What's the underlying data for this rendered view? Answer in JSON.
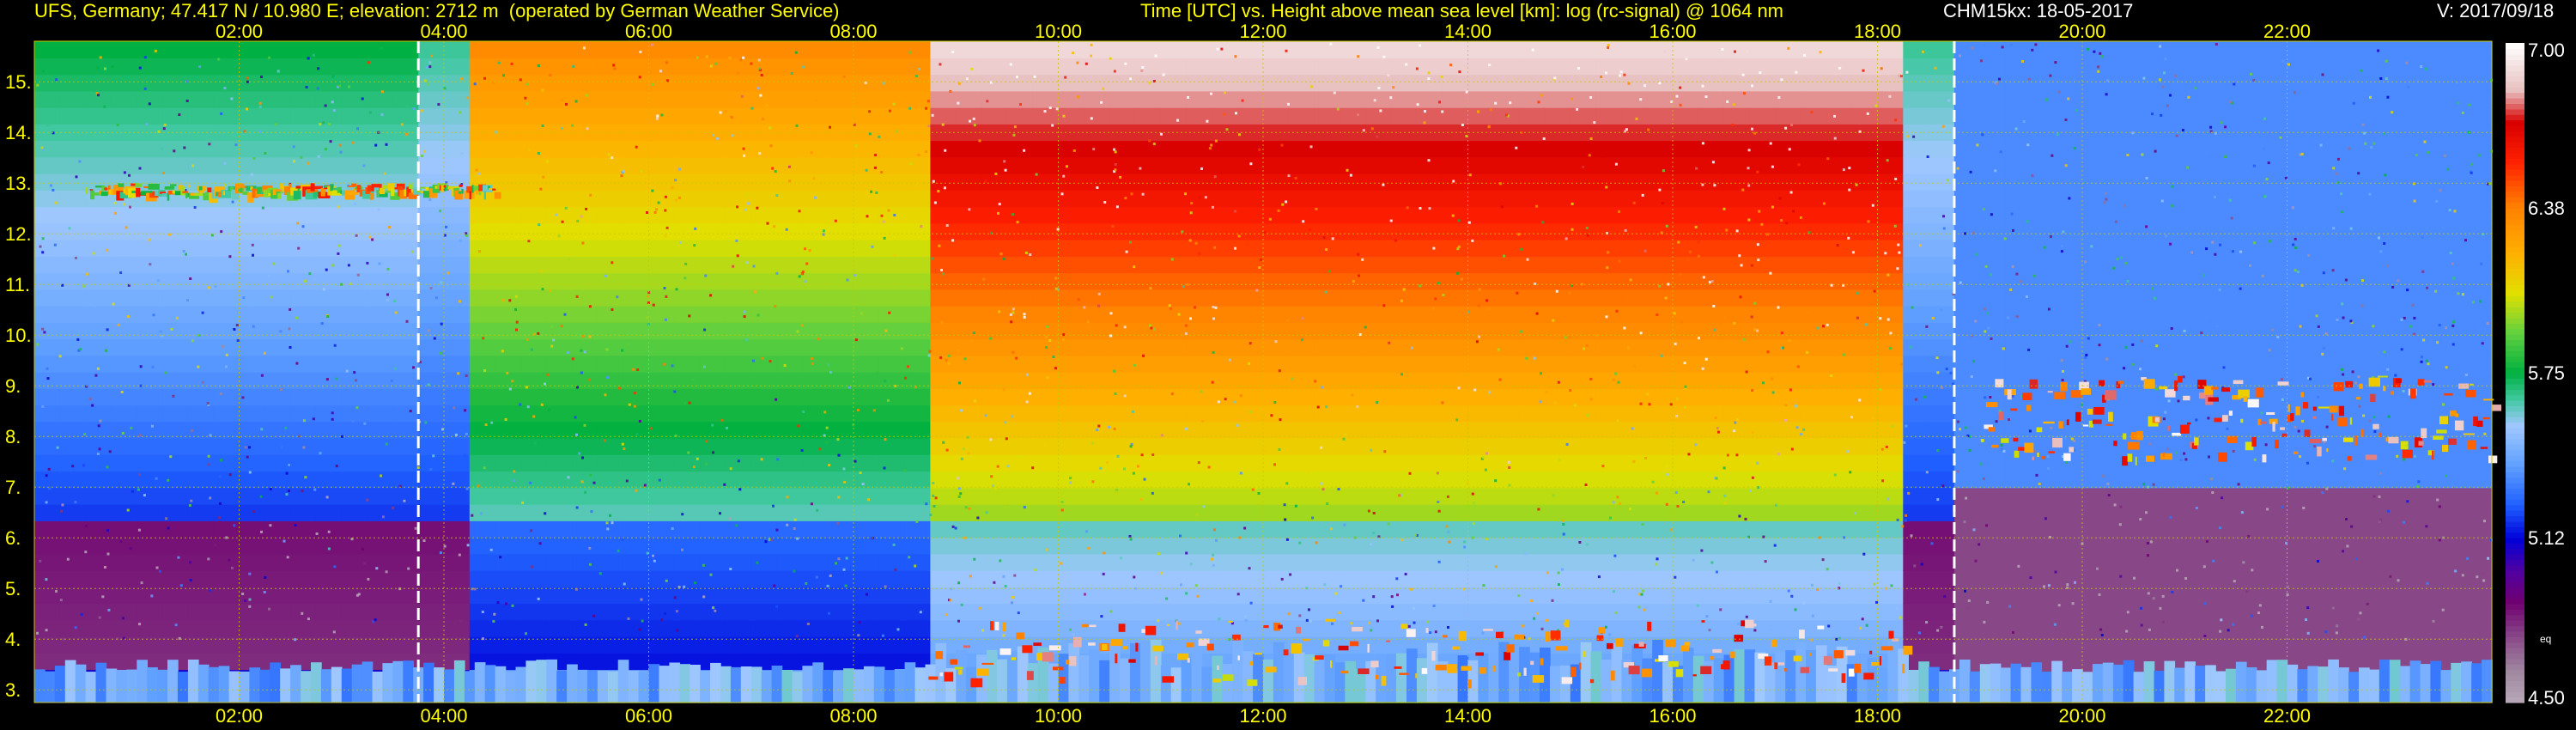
{
  "header": {
    "site": "UFS, Germany; 47.417 N / 10.980 E; elevation: 2712 m  (operated by German Weather Service)",
    "plot_description": "Time [UTC] vs. Height above mean sea level [km]: log (rc-signal) @ 1064 nm",
    "instrument_date": "CHM15kx: 18-05-2017",
    "version": "V: 2017/09/18"
  },
  "colors": {
    "background": "#000000",
    "grid": "#c8c800",
    "header_text": "#ffff00",
    "marker_lines": "#ffffff"
  },
  "chart_data": {
    "type": "heatmap",
    "title": "Time [UTC] vs. Height above mean sea level [km]: log (rc-signal) @ 1064 nm",
    "x_axis": {
      "quantity": "Time [UTC]",
      "range_hours": [
        0.0,
        24.0
      ],
      "ticks": [
        "02:00",
        "04:00",
        "06:00",
        "08:00",
        "10:00",
        "12:00",
        "14:00",
        "16:00",
        "18:00",
        "20:00",
        "22:00"
      ],
      "tick_hours": [
        2,
        4,
        6,
        8,
        10,
        12,
        14,
        16,
        18,
        20,
        22
      ],
      "labels_top_and_bottom": true
    },
    "y_axis": {
      "quantity": "Height above mean sea level [km]",
      "range_km": [
        2.75,
        15.8
      ],
      "ticks": [
        "3.",
        "4.",
        "5.",
        "6.",
        "7.",
        "8.",
        "9.",
        "10.",
        "11.",
        "12.",
        "13.",
        "14.",
        "15."
      ],
      "tick_values": [
        3,
        4,
        5,
        6,
        7,
        8,
        9,
        10,
        11,
        12,
        13,
        14,
        15
      ]
    },
    "grid": true,
    "vertical_markers_hours": [
      3.75,
      18.75
    ],
    "colorbar": {
      "placement": "right",
      "range": [
        4.5,
        7.0
      ],
      "ticks": [
        "7.00",
        "6.38",
        "5.75",
        "5.12",
        "4.50"
      ],
      "tick_values": [
        7.0,
        6.375,
        5.75,
        5.125,
        4.5
      ],
      "extra_label": "eq",
      "stops": [
        {
          "v": 4.5,
          "c": "#b8a8b8"
        },
        {
          "v": 4.62,
          "c": "#a088a0"
        },
        {
          "v": 4.75,
          "c": "#884888"
        },
        {
          "v": 4.88,
          "c": "#700070"
        },
        {
          "v": 5.0,
          "c": "#5000a0"
        },
        {
          "v": 5.12,
          "c": "#0000d8"
        },
        {
          "v": 5.25,
          "c": "#2060ff"
        },
        {
          "v": 5.4,
          "c": "#60a0ff"
        },
        {
          "v": 5.55,
          "c": "#a0c8ff"
        },
        {
          "v": 5.65,
          "c": "#40c8a0"
        },
        {
          "v": 5.75,
          "c": "#00b040"
        },
        {
          "v": 5.9,
          "c": "#60d040"
        },
        {
          "v": 6.05,
          "c": "#e0e000"
        },
        {
          "v": 6.2,
          "c": "#ffb000"
        },
        {
          "v": 6.38,
          "c": "#ff8000"
        },
        {
          "v": 6.55,
          "c": "#ff2000"
        },
        {
          "v": 6.7,
          "c": "#d80000"
        },
        {
          "v": 6.82,
          "c": "#e8c0c0"
        },
        {
          "v": 7.0,
          "c": "#ffffff"
        }
      ]
    },
    "features": [
      {
        "name": "thin cloud layer",
        "t_hours": [
          0.5,
          4.5
        ],
        "z_km": [
          12.8,
          13.0
        ],
        "peak_value": 6.6
      },
      {
        "name": "boundary layer tops",
        "t_hours": [
          8.7,
          18.3
        ],
        "z_km": [
          3.2,
          4.4
        ],
        "peak_value": 7.0
      },
      {
        "name": "mid-level cloud band",
        "t_hours": [
          19.0,
          24.0
        ],
        "z_km": [
          7.6,
          9.2
        ],
        "peak_value": 7.0
      }
    ]
  }
}
